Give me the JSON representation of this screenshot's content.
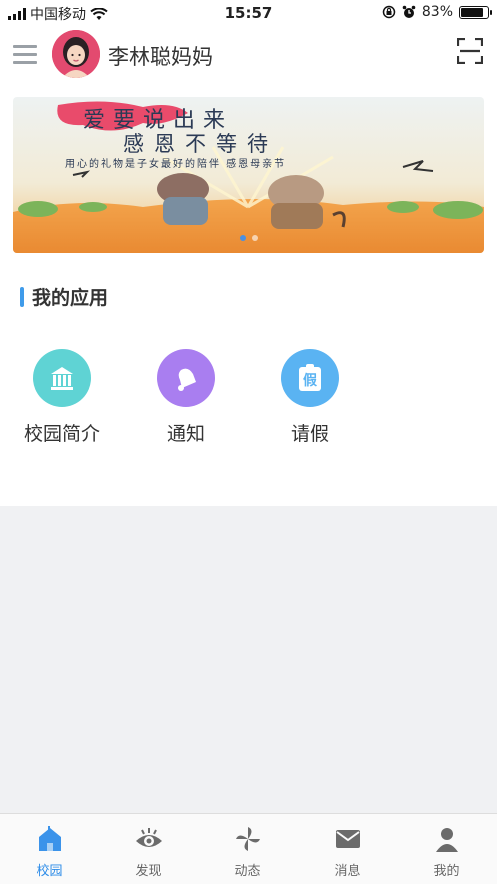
{
  "status_bar": {
    "carrier": "中国移动",
    "time": "15:57",
    "battery": "83%"
  },
  "header": {
    "title": "李林聪妈妈"
  },
  "banner": {
    "headline_1": "爱要说出来",
    "headline_2": "感恩不等待",
    "tagline": "用心的礼物是子女最好的陪伴 感恩母亲节"
  },
  "section": {
    "title": "我的应用"
  },
  "apps": [
    {
      "label": "校园简介",
      "icon": "building-icon",
      "color": "#5fd3d4"
    },
    {
      "label": "通知",
      "icon": "bell-icon",
      "color": "#a97ef0"
    },
    {
      "label": "请假",
      "icon": "leave-badge-icon",
      "color": "#5ab3f2",
      "glyph": "假"
    }
  ],
  "tabbar": [
    {
      "label": "校园",
      "icon": "school-icon",
      "active": true
    },
    {
      "label": "发现",
      "icon": "eye-icon",
      "active": false
    },
    {
      "label": "动态",
      "icon": "pinwheel-icon",
      "active": false
    },
    {
      "label": "消息",
      "icon": "mail-icon",
      "active": false
    },
    {
      "label": "我的",
      "icon": "person-icon",
      "active": false
    }
  ],
  "colors": {
    "accent": "#2d8ce8",
    "section_bar": "#3f9bea"
  }
}
